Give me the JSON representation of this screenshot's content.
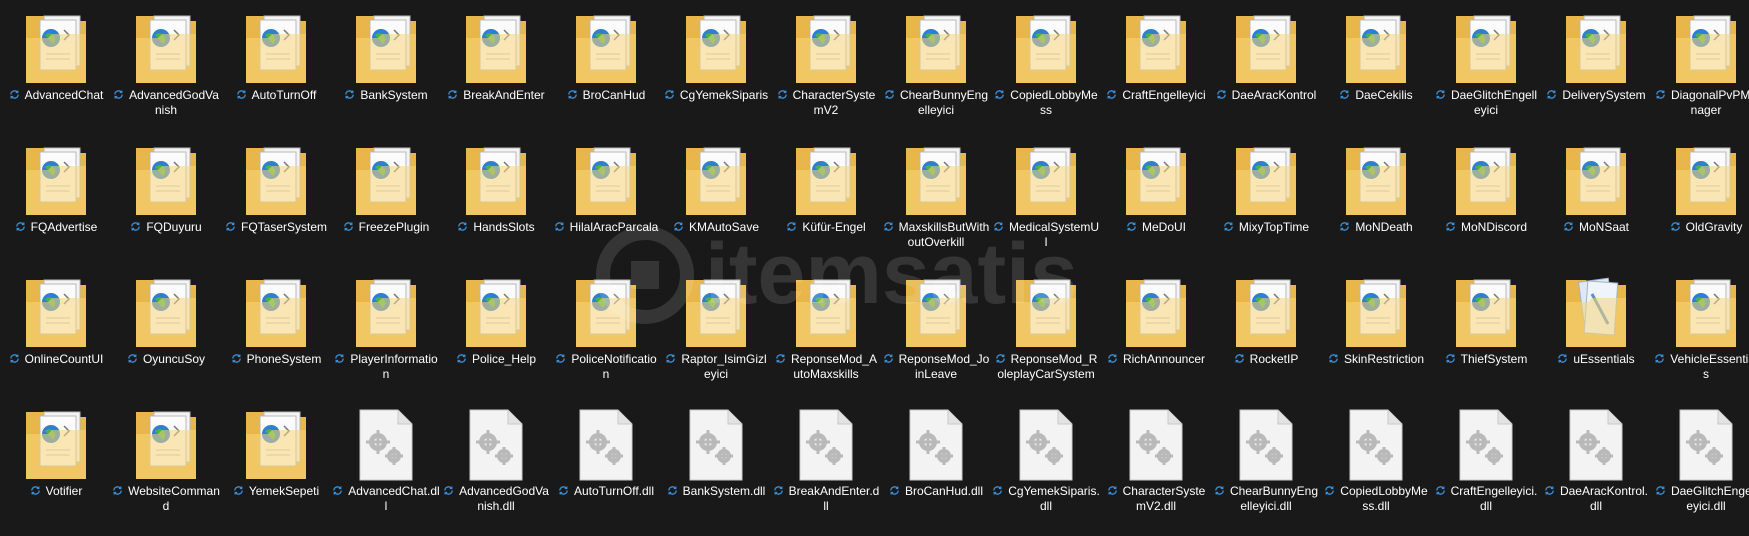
{
  "colors": {
    "background": "#191919",
    "folder_back": "#e8b64a",
    "folder_front": "#f7d57a",
    "sync_icon": "#3a8fd8",
    "label_text": "#ffffff"
  },
  "watermark": {
    "text": "itemsatis"
  },
  "files": [
    {
      "name": "AdvancedChat",
      "kind": "folder",
      "icon": "folder-globe-icon"
    },
    {
      "name": "AdvancedGodVanish",
      "kind": "folder",
      "icon": "folder-globe-icon"
    },
    {
      "name": "AutoTurnOff",
      "kind": "folder",
      "icon": "folder-globe-icon"
    },
    {
      "name": "BankSystem",
      "kind": "folder",
      "icon": "folder-globe-icon"
    },
    {
      "name": "BreakAndEnter",
      "kind": "folder",
      "icon": "folder-globe-icon"
    },
    {
      "name": "BroCanHud",
      "kind": "folder",
      "icon": "folder-globe-icon"
    },
    {
      "name": "CgYemekSiparis",
      "kind": "folder",
      "icon": "folder-globe-icon"
    },
    {
      "name": "CharacterSystemV2",
      "kind": "folder",
      "icon": "folder-globe-icon"
    },
    {
      "name": "ChearBunnyEngelleyici",
      "kind": "folder",
      "icon": "folder-globe-icon"
    },
    {
      "name": "CopiedLobbyMess",
      "kind": "folder",
      "icon": "folder-globe-icon"
    },
    {
      "name": "CraftEngelleyici",
      "kind": "folder",
      "icon": "folder-globe-icon"
    },
    {
      "name": "DaeAracKontrol",
      "kind": "folder",
      "icon": "folder-globe-icon"
    },
    {
      "name": "DaeCekilis",
      "kind": "folder",
      "icon": "folder-globe-icon"
    },
    {
      "name": "DaeGlitchEngelleyici",
      "kind": "folder",
      "icon": "folder-globe-icon"
    },
    {
      "name": "DeliverySystem",
      "kind": "folder",
      "icon": "folder-globe-icon"
    },
    {
      "name": "DiagonalPvPManager",
      "kind": "folder",
      "icon": "folder-globe-icon"
    },
    {
      "name": "FQAdvertise",
      "kind": "folder",
      "icon": "folder-globe-icon"
    },
    {
      "name": "FQDuyuru",
      "kind": "folder",
      "icon": "folder-globe-icon"
    },
    {
      "name": "FQTaserSystem",
      "kind": "folder",
      "icon": "folder-globe-icon"
    },
    {
      "name": "FreezePlugin",
      "kind": "folder",
      "icon": "folder-globe-icon"
    },
    {
      "name": "HandsSlots",
      "kind": "folder",
      "icon": "folder-globe-icon"
    },
    {
      "name": "HilalAracParcala",
      "kind": "folder",
      "icon": "folder-globe-icon"
    },
    {
      "name": "KMAutoSave",
      "kind": "folder",
      "icon": "folder-globe-icon"
    },
    {
      "name": "Küfür-Engel",
      "kind": "folder",
      "icon": "folder-globe-icon"
    },
    {
      "name": "MaxskillsButWithoutOverkill",
      "kind": "folder",
      "icon": "folder-globe-icon"
    },
    {
      "name": "MedicalSystemUI",
      "kind": "folder",
      "icon": "folder-globe-icon"
    },
    {
      "name": "MeDoUI",
      "kind": "folder",
      "icon": "folder-globe-icon"
    },
    {
      "name": "MixyTopTime",
      "kind": "folder",
      "icon": "folder-globe-icon"
    },
    {
      "name": "MoNDeath",
      "kind": "folder",
      "icon": "folder-globe-icon"
    },
    {
      "name": "MoNDiscord",
      "kind": "folder",
      "icon": "folder-globe-icon"
    },
    {
      "name": "MoNSaat",
      "kind": "folder",
      "icon": "folder-globe-icon"
    },
    {
      "name": "OldGravity",
      "kind": "folder",
      "icon": "folder-globe-icon"
    },
    {
      "name": "OnlineCountUI",
      "kind": "folder",
      "icon": "folder-globe-icon"
    },
    {
      "name": "OyuncuSoy",
      "kind": "folder",
      "icon": "folder-globe-icon"
    },
    {
      "name": "PhoneSystem",
      "kind": "folder",
      "icon": "folder-globe-icon"
    },
    {
      "name": "PlayerInformation",
      "kind": "folder",
      "icon": "folder-globe-icon"
    },
    {
      "name": "Police_Help",
      "kind": "folder",
      "icon": "folder-globe-icon"
    },
    {
      "name": "PoliceNotification",
      "kind": "folder",
      "icon": "folder-globe-icon"
    },
    {
      "name": "Raptor_IsimGizleyici",
      "kind": "folder",
      "icon": "folder-globe-icon"
    },
    {
      "name": "ReponseMod_AutoMaxskills",
      "kind": "folder",
      "icon": "folder-globe-icon"
    },
    {
      "name": "ReponseMod_JoinLeave",
      "kind": "folder",
      "icon": "folder-globe-icon"
    },
    {
      "name": "ReponseMod_RoleplayCarSystem",
      "kind": "folder",
      "icon": "folder-globe-icon"
    },
    {
      "name": "RichAnnouncer",
      "kind": "folder",
      "icon": "folder-globe-icon"
    },
    {
      "name": "RocketIP",
      "kind": "folder",
      "icon": "folder-globe-icon"
    },
    {
      "name": "SkinRestriction",
      "kind": "folder",
      "icon": "folder-globe-icon"
    },
    {
      "name": "ThiefSystem",
      "kind": "folder",
      "icon": "folder-globe-icon"
    },
    {
      "name": "uEssentials",
      "kind": "folder",
      "icon": "folder-notepad-icon"
    },
    {
      "name": "VehicleEssentials",
      "kind": "folder",
      "icon": "folder-globe-icon"
    },
    {
      "name": "Votifier",
      "kind": "folder",
      "icon": "folder-globe-icon"
    },
    {
      "name": "WebsiteCommand",
      "kind": "folder",
      "icon": "folder-globe-icon"
    },
    {
      "name": "YemekSepeti",
      "kind": "folder",
      "icon": "folder-globe-icon"
    },
    {
      "name": "AdvancedChat.dll",
      "kind": "dll",
      "icon": "dll-gears-icon"
    },
    {
      "name": "AdvancedGodVanish.dll",
      "kind": "dll",
      "icon": "dll-gears-icon"
    },
    {
      "name": "AutoTurnOff.dll",
      "kind": "dll",
      "icon": "dll-gears-icon"
    },
    {
      "name": "BankSystem.dll",
      "kind": "dll",
      "icon": "dll-gears-icon"
    },
    {
      "name": "BreakAndEnter.dll",
      "kind": "dll",
      "icon": "dll-gears-icon"
    },
    {
      "name": "BroCanHud.dll",
      "kind": "dll",
      "icon": "dll-gears-icon"
    },
    {
      "name": "CgYemekSiparis.dll",
      "kind": "dll",
      "icon": "dll-gears-icon"
    },
    {
      "name": "CharacterSystemV2.dll",
      "kind": "dll",
      "icon": "dll-gears-icon"
    },
    {
      "name": "ChearBunnyEngelleyici.dll",
      "kind": "dll",
      "icon": "dll-gears-icon"
    },
    {
      "name": "CopiedLobbyMess.dll",
      "kind": "dll",
      "icon": "dll-gears-icon"
    },
    {
      "name": "CraftEngelleyici.dll",
      "kind": "dll",
      "icon": "dll-gears-icon"
    },
    {
      "name": "DaeAracKontrol.dll",
      "kind": "dll",
      "icon": "dll-gears-icon"
    },
    {
      "name": "DaeGlitchEngelleyici.dll",
      "kind": "dll",
      "icon": "dll-gears-icon"
    }
  ]
}
